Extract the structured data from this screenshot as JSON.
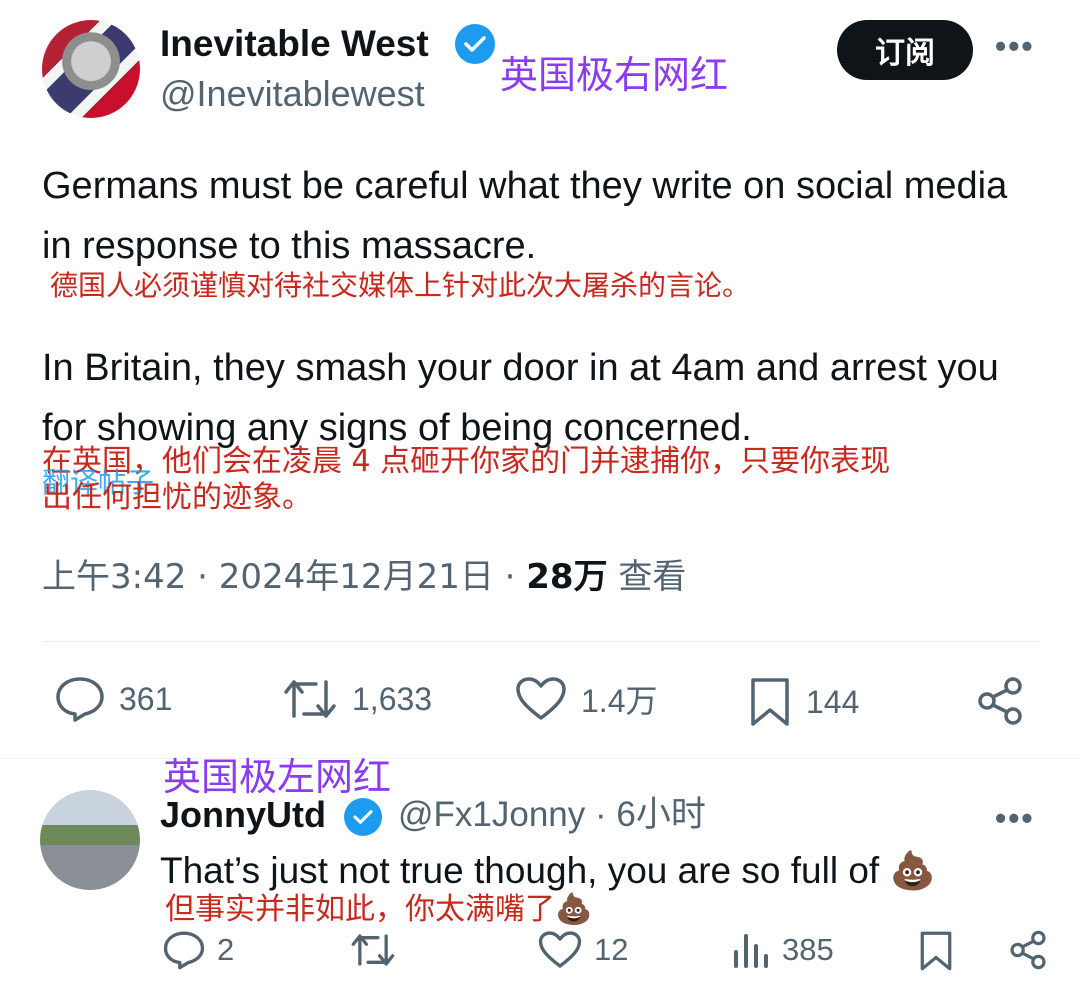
{
  "author": {
    "name": "Inevitable West",
    "handle": "@Inevitablewest",
    "annotation": "英国极右网红"
  },
  "header": {
    "subscribe_label": "订阅",
    "more_label": "•••"
  },
  "tweet": {
    "para1": "Germans must be careful what they write on social media in response to this massacre.",
    "para1_translation": "德国人必须谨慎对待社交媒体上针对此次大屠杀的言论。",
    "para2": "In Britain, they smash your door in at 4am and arrest you for showing any signs of being concerned.",
    "para2_translation_line1": "在英国，他们会在凌晨 4 点砸开你家的门并逮捕你，只要你表现",
    "para2_translation_line2": "出任何担忧的迹象。",
    "translate_link": "翻译帖子",
    "time": "上午3:42 · 2024年12月21日 · ",
    "views_count": "28万",
    "views_label": " 查看"
  },
  "stats": {
    "replies": "361",
    "reposts": "1,633",
    "likes": "1.4万",
    "bookmarks": "144"
  },
  "reply": {
    "annotation": "英国极左网红",
    "name": "JonnyUtd",
    "handle_time": "@Fx1Jonny · 6小时",
    "text": "That’s just not true though, you are so full of 💩",
    "translation": "但事实并非如此，你太满嘴了💩",
    "more_label": "•••",
    "stats": {
      "replies": "2",
      "likes": "12",
      "views": "385"
    }
  },
  "colors": {
    "verified": "#1d9bf0",
    "annotation_purple": "#8a3cf0",
    "annotation_red": "#c8291f",
    "muted": "#536471"
  }
}
